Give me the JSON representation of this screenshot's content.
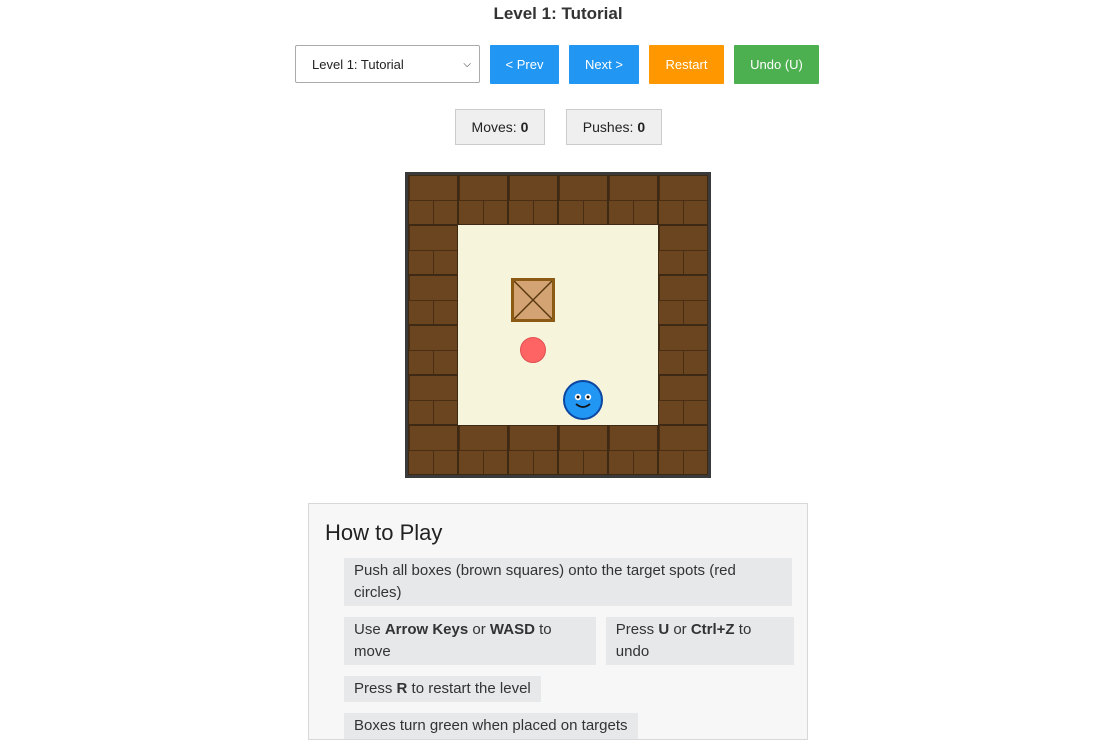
{
  "title": "Level 1: Tutorial",
  "controls": {
    "level_select": "Level 1: Tutorial",
    "prev_label": "< Prev",
    "next_label": "Next >",
    "restart_label": "Restart",
    "undo_label": "Undo (U)"
  },
  "stats": {
    "moves_label": "Moves:",
    "moves_value": "0",
    "pushes_label": "Pushes:",
    "pushes_value": "0"
  },
  "board": {
    "cols": 6,
    "rows": 6,
    "map": [
      "######",
      "#    #",
      "# $  #",
      "# .  #",
      "#  @ #",
      "######"
    ],
    "legend": {
      "#": "wall",
      " ": "floor",
      "$": "box",
      ".": "target",
      "@": "player"
    }
  },
  "colors": {
    "prev": "#2196f3",
    "next": "#2196f3",
    "restart": "#ff9800",
    "undo": "#4caf50",
    "wall": "#6b4420",
    "floor": "#f6f5dc",
    "box": "#d4a373",
    "target": "#ff6464",
    "player": "#2196f3"
  },
  "howto": {
    "heading": "How to Play",
    "tip1": "Push all boxes (brown squares) onto the target spots (red circles)",
    "tip2_a": "Use ",
    "tip2_b": "Arrow Keys",
    "tip2_c": " or ",
    "tip2_d": "WASD",
    "tip2_e": " to move",
    "tip3_a": "Press ",
    "tip3_b": "U",
    "tip3_c": " or ",
    "tip3_d": "Ctrl+Z",
    "tip3_e": " to undo",
    "tip4_a": "Press ",
    "tip4_b": "R",
    "tip4_c": " to restart the level",
    "tip5": "Boxes turn green when placed on targets"
  }
}
